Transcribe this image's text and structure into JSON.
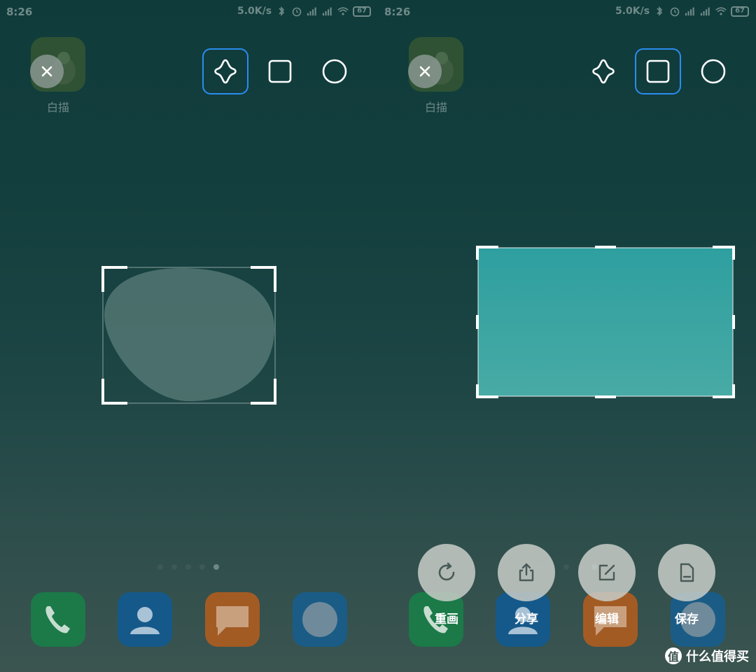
{
  "left": {
    "status": {
      "time": "8:26",
      "speed": "5.0K/s",
      "battery": "67"
    },
    "app": {
      "label": "白描"
    },
    "page_dots": 5,
    "active_dot": 4
  },
  "right": {
    "status": {
      "time": "8:26",
      "speed": "5.0K/s",
      "battery": "67"
    },
    "app": {
      "label": "白描"
    },
    "actions": {
      "redraw": "重画",
      "share": "分享",
      "edit": "编辑",
      "save": "保存"
    }
  },
  "watermark": {
    "logo": "值",
    "text": "什么值得买"
  },
  "colors": {
    "accent": "#2b8cf0",
    "selection_fill": "#3aa6a3"
  }
}
